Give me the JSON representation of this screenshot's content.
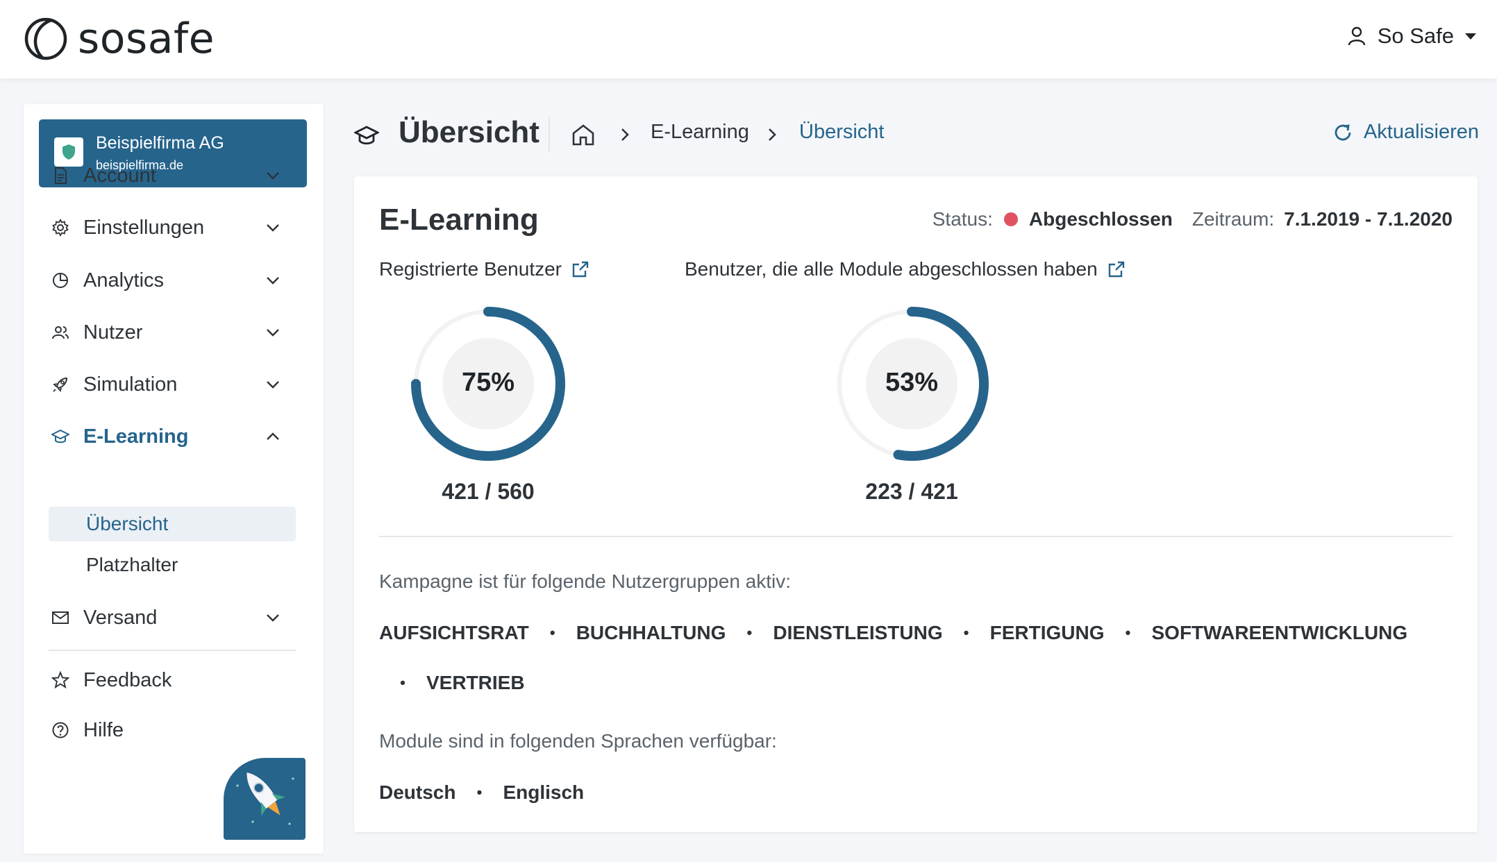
{
  "header": {
    "logo_text": "sosafe",
    "user_name": "So Safe"
  },
  "sidebar": {
    "company": {
      "name": "Beispielfirma AG",
      "domain": "beispielfirma.de"
    },
    "items": [
      {
        "label": "Account",
        "icon": "document-icon"
      },
      {
        "label": "Einstellungen",
        "icon": "gear-icon"
      },
      {
        "label": "Analytics",
        "icon": "pie-chart-icon"
      },
      {
        "label": "Nutzer",
        "icon": "users-icon"
      },
      {
        "label": "Simulation",
        "icon": "rocket-icon"
      },
      {
        "label": "E-Learning",
        "icon": "graduation-cap-icon",
        "expanded": true
      },
      {
        "label": "Versand",
        "icon": "mail-icon"
      }
    ],
    "elearning_sub": [
      "Übersicht",
      "Platzhalter"
    ],
    "footer_items": [
      {
        "label": "Feedback",
        "icon": "star-icon"
      },
      {
        "label": "Hilfe",
        "icon": "help-icon"
      }
    ]
  },
  "page": {
    "title": "Übersicht",
    "breadcrumb": [
      "E-Learning",
      "Übersicht"
    ],
    "refresh_label": "Aktualisieren"
  },
  "card": {
    "title": "E-Learning",
    "status_label": "Status:",
    "status_value": "Abgeschlossen",
    "status_color": "#e05260",
    "period_label": "Zeitraum:",
    "period_value": "7.1.2019 - 7.1.2020",
    "metrics": [
      {
        "label": "Registrierte Benutzer",
        "percent": 75,
        "percent_text": "75%",
        "count_text": "421 / 560"
      },
      {
        "label": "Benutzer, die alle Module abgeschlossen haben",
        "percent": 53,
        "percent_text": "53%",
        "count_text": "223 / 421"
      }
    ],
    "groups_label": "Kampagne ist für folgende Nutzergruppen aktiv:",
    "groups": [
      "AUFSICHTSRAT",
      "BUCHHALTUNG",
      "DIENSTLEISTUNG",
      "FERTIGUNG",
      "SOFTWAREENTWICKLUNG",
      "VERTRIEB"
    ],
    "languages_label": "Module sind in folgenden Sprachen verfügbar:",
    "languages": [
      "Deutsch",
      "Englisch"
    ]
  },
  "colors": {
    "accent": "#26648c",
    "gauge_track": "#f2f2f2"
  }
}
